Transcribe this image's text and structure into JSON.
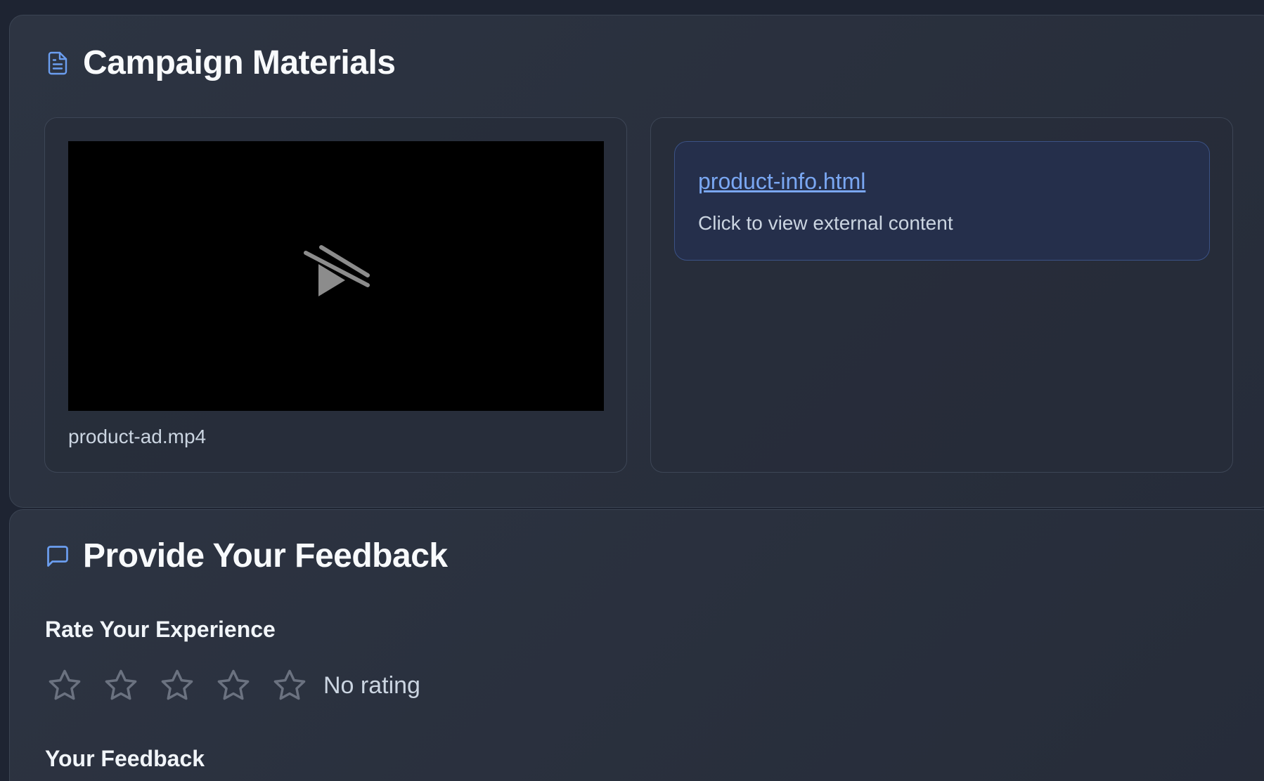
{
  "materials": {
    "title": "Campaign Materials",
    "icon": "document-icon",
    "video": {
      "filename": "product-ad.mp4",
      "icon": "video-unavailable-icon"
    },
    "link": {
      "title": "product-info.html",
      "description": "Click to view external content"
    }
  },
  "feedback": {
    "title": "Provide Your Feedback",
    "icon": "message-icon",
    "rating_label": "Rate Your Experience",
    "rating": {
      "value": 0,
      "max": 5,
      "text": "No rating"
    },
    "feedback_label": "Your Feedback"
  },
  "colors": {
    "accent": "#6b9ef0",
    "link": "#7aa7f2",
    "star_outline": "#6b7280"
  }
}
